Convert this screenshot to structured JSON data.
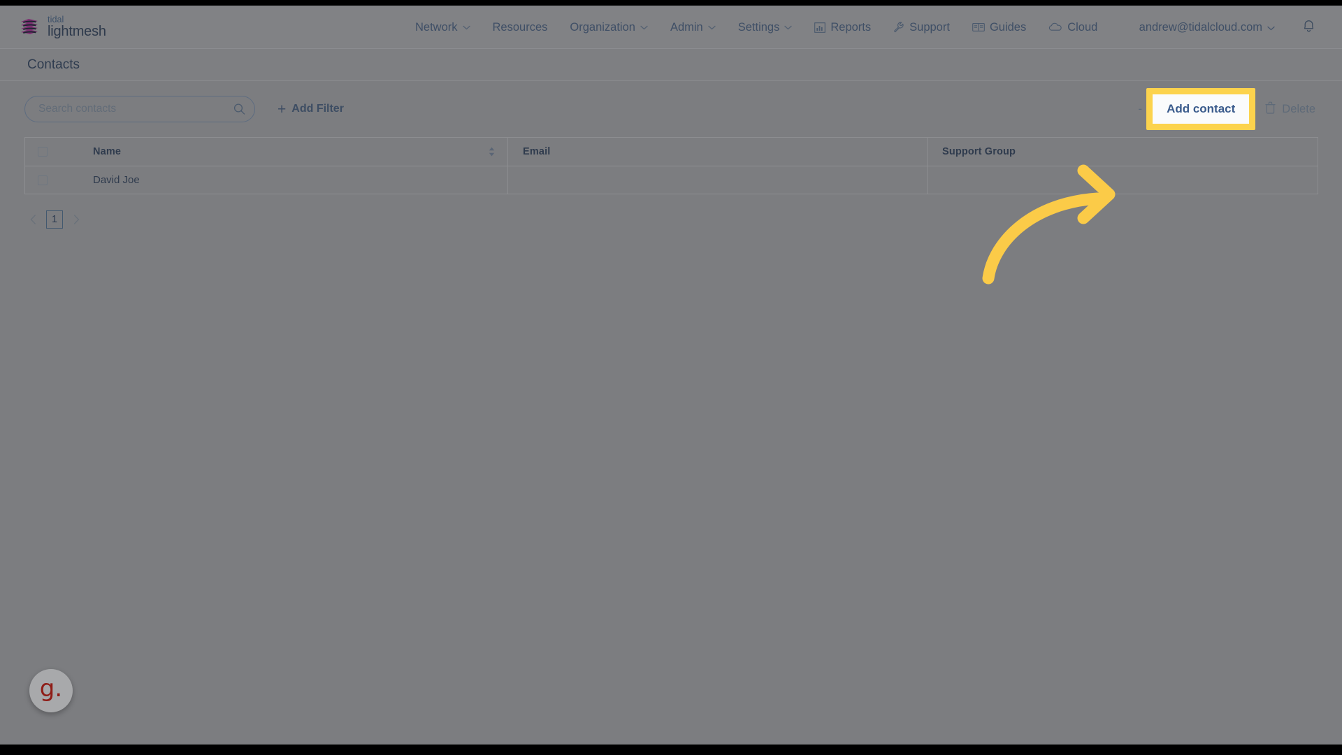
{
  "brand": {
    "top": "tidal",
    "bottom": "lightmesh",
    "mark_icon": "stacked-layers-logo-icon",
    "colors": {
      "purple": "#7d2f72",
      "dark": "#1d2430"
    }
  },
  "nav": {
    "items": [
      {
        "label": "Network",
        "has_chevron": true,
        "icon": null
      },
      {
        "label": "Resources",
        "has_chevron": false,
        "icon": null
      },
      {
        "label": "Organization",
        "has_chevron": true,
        "icon": null
      },
      {
        "label": "Admin",
        "has_chevron": true,
        "icon": null
      },
      {
        "label": "Settings",
        "has_chevron": true,
        "icon": null
      },
      {
        "label": "Reports",
        "has_chevron": false,
        "icon": "bar-chart-icon"
      },
      {
        "label": "Support",
        "has_chevron": false,
        "icon": "wrench-icon"
      },
      {
        "label": "Guides",
        "has_chevron": false,
        "icon": "book-icon"
      },
      {
        "label": "Cloud",
        "has_chevron": false,
        "icon": "cloud-icon"
      }
    ],
    "user": {
      "email": "andrew@tidalcloud.com",
      "has_chevron": true
    },
    "notification_icon": "bell-icon"
  },
  "page": {
    "title": "Contacts"
  },
  "toolbar": {
    "search": {
      "placeholder": "Search contacts",
      "value": "",
      "icon": "search-icon"
    },
    "add_filter": {
      "label": "Add Filter",
      "plus": "+"
    },
    "separator": "-",
    "add_contact": {
      "label": "Add contact",
      "highlighted": true,
      "highlight_color": "#fcd34d"
    },
    "delete": {
      "label": "Delete",
      "icon": "trash-icon",
      "disabled": true
    }
  },
  "table": {
    "columns": [
      {
        "key": "name",
        "label": "Name",
        "sortable": true
      },
      {
        "key": "email",
        "label": "Email",
        "sortable": false
      },
      {
        "key": "group",
        "label": "Support Group",
        "sortable": false
      }
    ],
    "rows": [
      {
        "name": "David Joe",
        "email": "",
        "group": ""
      }
    ]
  },
  "pagination": {
    "prev_icon": "chevron-left-icon",
    "next_icon": "chevron-right-icon",
    "pages": [
      "1"
    ],
    "current": "1"
  },
  "widget": {
    "guidde_label": "g.",
    "color": "#8f1d17"
  },
  "annotation": {
    "arrow_color": "#fbcb48",
    "arrow_points_to": "Add contact",
    "highlight_target": "add-contact-button"
  }
}
